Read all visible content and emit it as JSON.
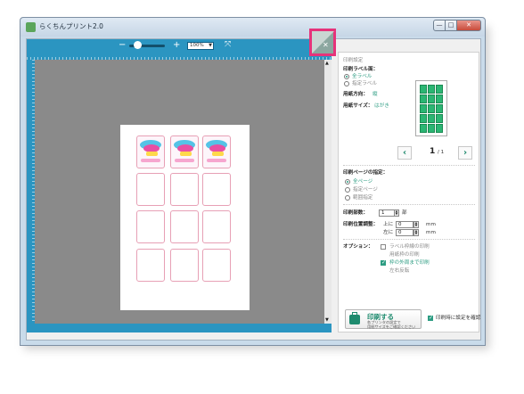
{
  "window": {
    "title": "らくちんプリント2.0",
    "min": "—",
    "max": "□",
    "close": "✕"
  },
  "toolbar": {
    "minus": "−",
    "plus": "+",
    "zoom": "100%",
    "zoom_arrow": "▼",
    "fit": "⤧"
  },
  "panel": {
    "section_top": "印刷設定",
    "label_side_heading": "印刷ラベル面：",
    "label_side_options": [
      "全ラベル",
      "指定ラベル"
    ],
    "orientation_label": "用紙方向：",
    "orientation_value": "縦",
    "size_label": "用紙サイズ：",
    "size_value": "はがき",
    "page_current": "1",
    "page_total": "/ 1",
    "prev": "‹",
    "next": "›",
    "print_page_heading": "印刷ページの指定：",
    "print_page_options": [
      "全ページ",
      "指定ページ",
      "範囲指定"
    ],
    "copies_label": "印刷部数：",
    "copies_value": "1",
    "copies_unit": "部",
    "offset_label": "印刷位置調整：",
    "offset_up_label": "上に",
    "offset_up_value": "0",
    "offset_left_label": "左に",
    "offset_left_value": "0",
    "offset_unit": "mm",
    "options_label": "オプション：",
    "opt_frame": "ラベル枠線の印刷",
    "opt_paper": "用紙枠の印刷",
    "opt_fit": "枠の外周まで印刷",
    "opt_mirror": "左右反転",
    "print_button": "印刷する",
    "print_sub1": "各プリンタの設定で",
    "print_sub2": "用紙サイズをご確認ください",
    "confirm_label": "印刷時に設定を確認"
  },
  "colors": {
    "accent": "#2b95c1",
    "green": "#2c9c82",
    "pink": "#e6337a"
  }
}
